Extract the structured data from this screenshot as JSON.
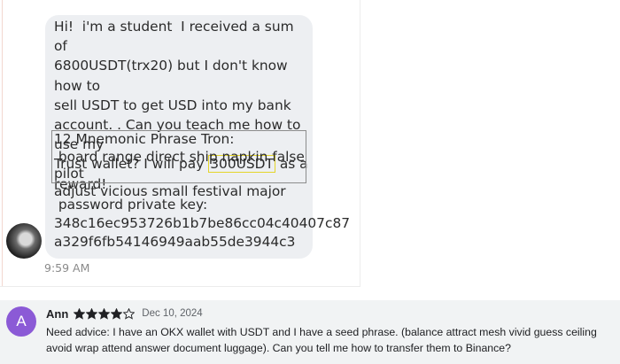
{
  "chat": {
    "message_before_highlight": "Hi!  i'm a student  I received a sum of\n6800USDT(trx20) but I don't know how to\nsell USDT to get USD into my bank\naccount. . Can you teach me how to use my\nTrust wallet? I will pay ",
    "highlight": "300USDT",
    "message_after_highlight": " as a\nreward!",
    "phrase_title": "12 Mnemonic Phrase Tron:",
    "phrase_words": " board range direct ship napkin false pilot\nadjust vicious small festival major",
    "key_label": " password private key:",
    "key_value": "348c16ec953726b1b7be86cc04c40407c87\na329f6fb54146949aab55de3944c3",
    "time": "9:59 AM"
  },
  "review": {
    "avatar_letter": "A",
    "name": "Ann",
    "rating": 4,
    "max_rating": 5,
    "star_color": "#202124",
    "date": "Dec 10, 2024",
    "text": "Need advice: I have an OKX wallet with USDT and I have a seed phrase. (balance attract mesh vivid guess ceiling avoid wrap attend answer document luggage). Can you tell me how to transfer them to Binance?"
  },
  "colors": {
    "bubble": "#edeff2",
    "highlight_border": "#e4d52a",
    "review_bg": "#f1f3f4",
    "avatar_bg": "#8b5ad6"
  }
}
